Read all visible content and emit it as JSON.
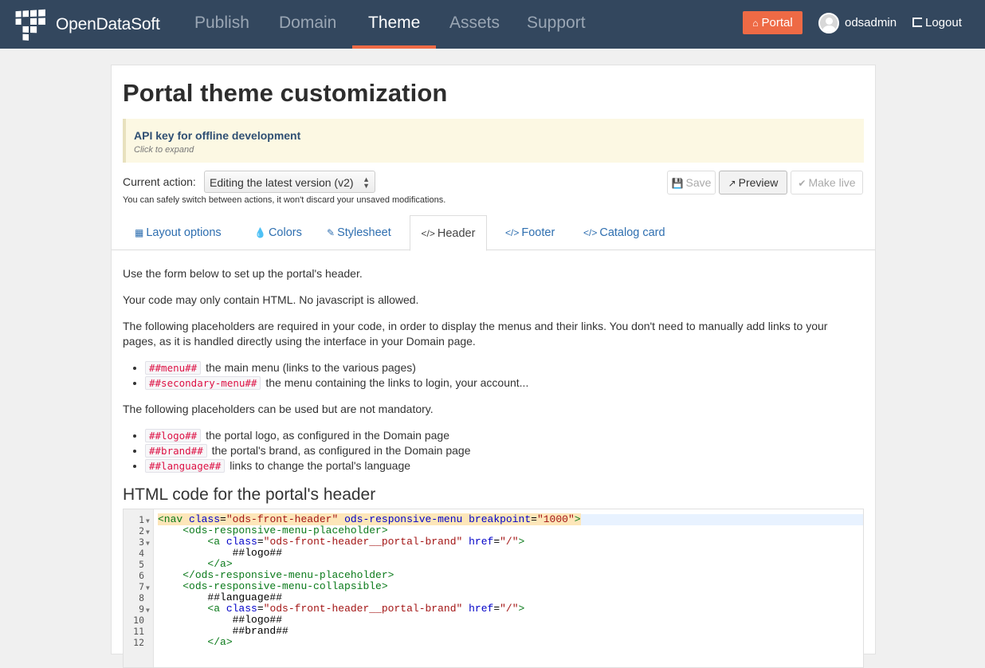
{
  "topbar": {
    "brand": "OpenDataSoft",
    "tabs": [
      "Publish",
      "Domain",
      "Theme",
      "Assets",
      "Support"
    ],
    "active_tab": "Theme",
    "portal_button": "Portal",
    "username": "odsadmin",
    "logout": "Logout",
    "accent_color": "#ee6a45",
    "bar_color": "#33475e"
  },
  "page": {
    "title": "Portal theme customization",
    "api_key": {
      "heading": "API key for offline development",
      "subtext": "Click to expand"
    },
    "current_action_label": "Current action:",
    "current_action_value": "Editing the latest version (v2)",
    "hint": "You can safely switch between actions, it won't discard your unsaved modifications.",
    "buttons": {
      "save": "Save",
      "preview": "Preview",
      "make_live": "Make live"
    },
    "tabs": [
      {
        "label": "Layout options",
        "icon": "grid-icon"
      },
      {
        "label": "Colors",
        "icon": "droplet-icon"
      },
      {
        "label": "Stylesheet",
        "icon": "pencil-icon"
      },
      {
        "label": "Header",
        "icon": "code-icon"
      },
      {
        "label": "Footer",
        "icon": "code-icon"
      },
      {
        "label": "Catalog card",
        "icon": "code-icon"
      }
    ],
    "active_tab": "Header",
    "intro1": "Use the form below to set up the portal's header.",
    "intro2": "Your code may only contain HTML. No javascript is allowed.",
    "intro3": "The following placeholders are required in your code, in order to display the menus and their links. You don't need to manually add links to your pages, as it is handled directly using the interface in your Domain page.",
    "required": [
      {
        "code": "##menu##",
        "text": "the main menu (links to the various pages)"
      },
      {
        "code": "##secondary-menu##",
        "text": "the menu containing the links to login, your account..."
      }
    ],
    "intro4": "The following placeholders can be used but are not mandatory.",
    "optional": [
      {
        "code": "##logo##",
        "text": "the portal logo, as configured in the Domain page"
      },
      {
        "code": "##brand##",
        "text": "the portal's brand, as configured in the Domain page"
      },
      {
        "code": "##language##",
        "text": "links to change the portal's language"
      }
    ],
    "code_title": "HTML code for the portal's header",
    "code_lines": [
      "<nav class=\"ods-front-header\" ods-responsive-menu breakpoint=\"1000\">",
      "    <ods-responsive-menu-placeholder>",
      "        <a class=\"ods-front-header__portal-brand\" href=\"/\">",
      "            ##logo##",
      "        </a>",
      "    </ods-responsive-menu-placeholder>",
      "    <ods-responsive-menu-collapsible>",
      "        ##language##",
      "        <a class=\"ods-front-header__portal-brand\" href=\"/\">",
      "            ##logo##",
      "            ##brand##",
      "        </a>"
    ],
    "line_numbers": [
      "1",
      "2",
      "3",
      "4",
      "5",
      "6",
      "7",
      "8",
      "9",
      "10",
      "11",
      "12"
    ]
  }
}
